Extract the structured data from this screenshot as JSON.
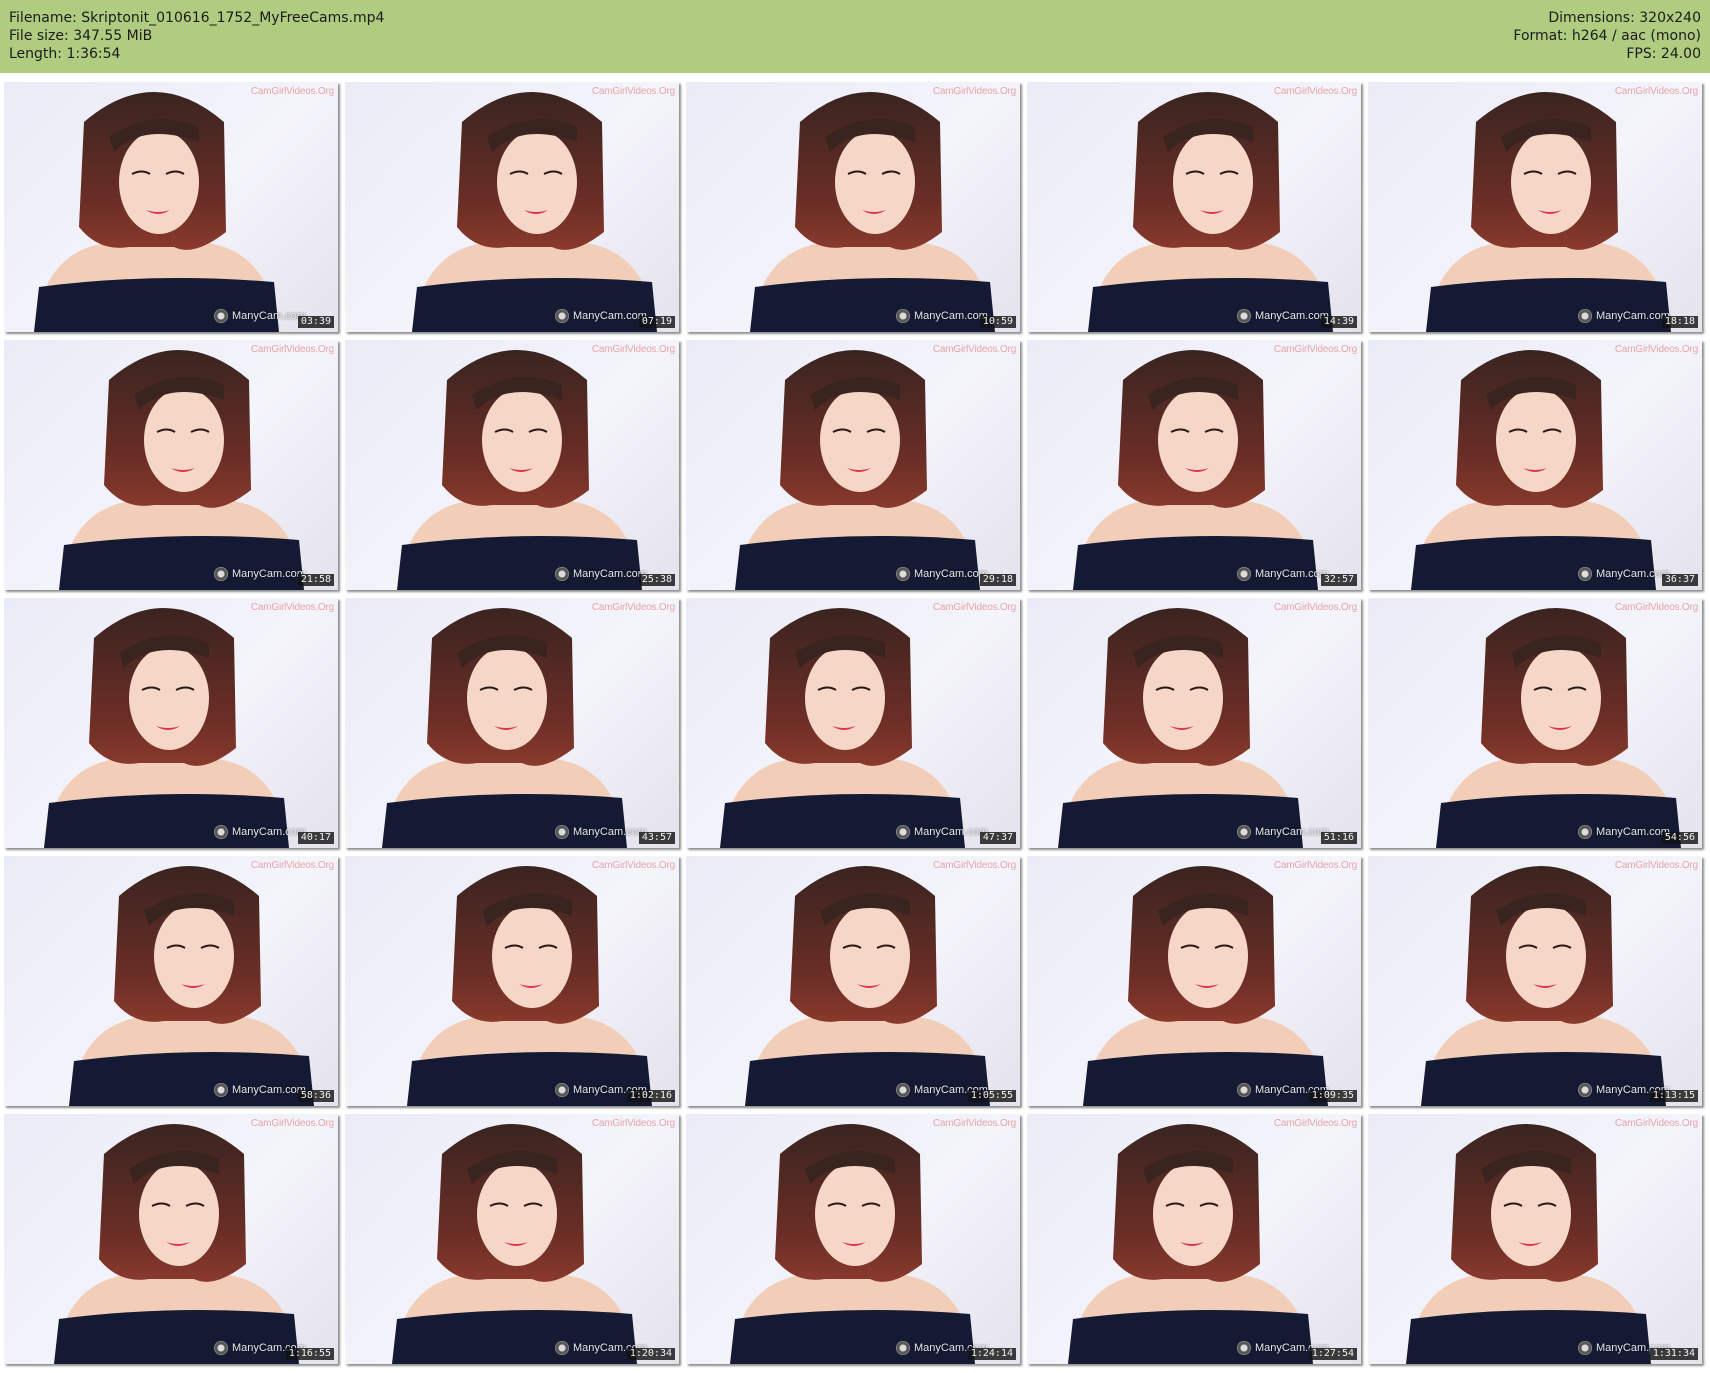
{
  "header": {
    "filename": "Filename: Skriptonit_010616_1752_MyFreeCams.mp4",
    "file_size": "File size: 347.55 MiB",
    "length": "Length: 1:36:54",
    "dimensions": "Dimensions: 320x240",
    "format": "Format: h264 / aac (mono)",
    "fps": "FPS: 24.00"
  },
  "watermarks": {
    "top": "CamGirlVideos.Org",
    "bottom": "ManyCam.com"
  },
  "colors": {
    "header_bg": "#afcc81",
    "page_bg": "#ffffff"
  },
  "thumbnails": [
    {
      "time": "03:39"
    },
    {
      "time": "07:19"
    },
    {
      "time": "10:59"
    },
    {
      "time": "14:39"
    },
    {
      "time": "18:18"
    },
    {
      "time": "21:58"
    },
    {
      "time": "25:38"
    },
    {
      "time": "29:18"
    },
    {
      "time": "32:57"
    },
    {
      "time": "36:37"
    },
    {
      "time": "40:17"
    },
    {
      "time": "43:57"
    },
    {
      "time": "47:37"
    },
    {
      "time": "51:16"
    },
    {
      "time": "54:56"
    },
    {
      "time": "58:36"
    },
    {
      "time": "1:02:16"
    },
    {
      "time": "1:05:55"
    },
    {
      "time": "1:09:35"
    },
    {
      "time": "1:13:15"
    },
    {
      "time": "1:16:55"
    },
    {
      "time": "1:20:34"
    },
    {
      "time": "1:24:14"
    },
    {
      "time": "1:27:54"
    },
    {
      "time": "1:31:34"
    }
  ]
}
